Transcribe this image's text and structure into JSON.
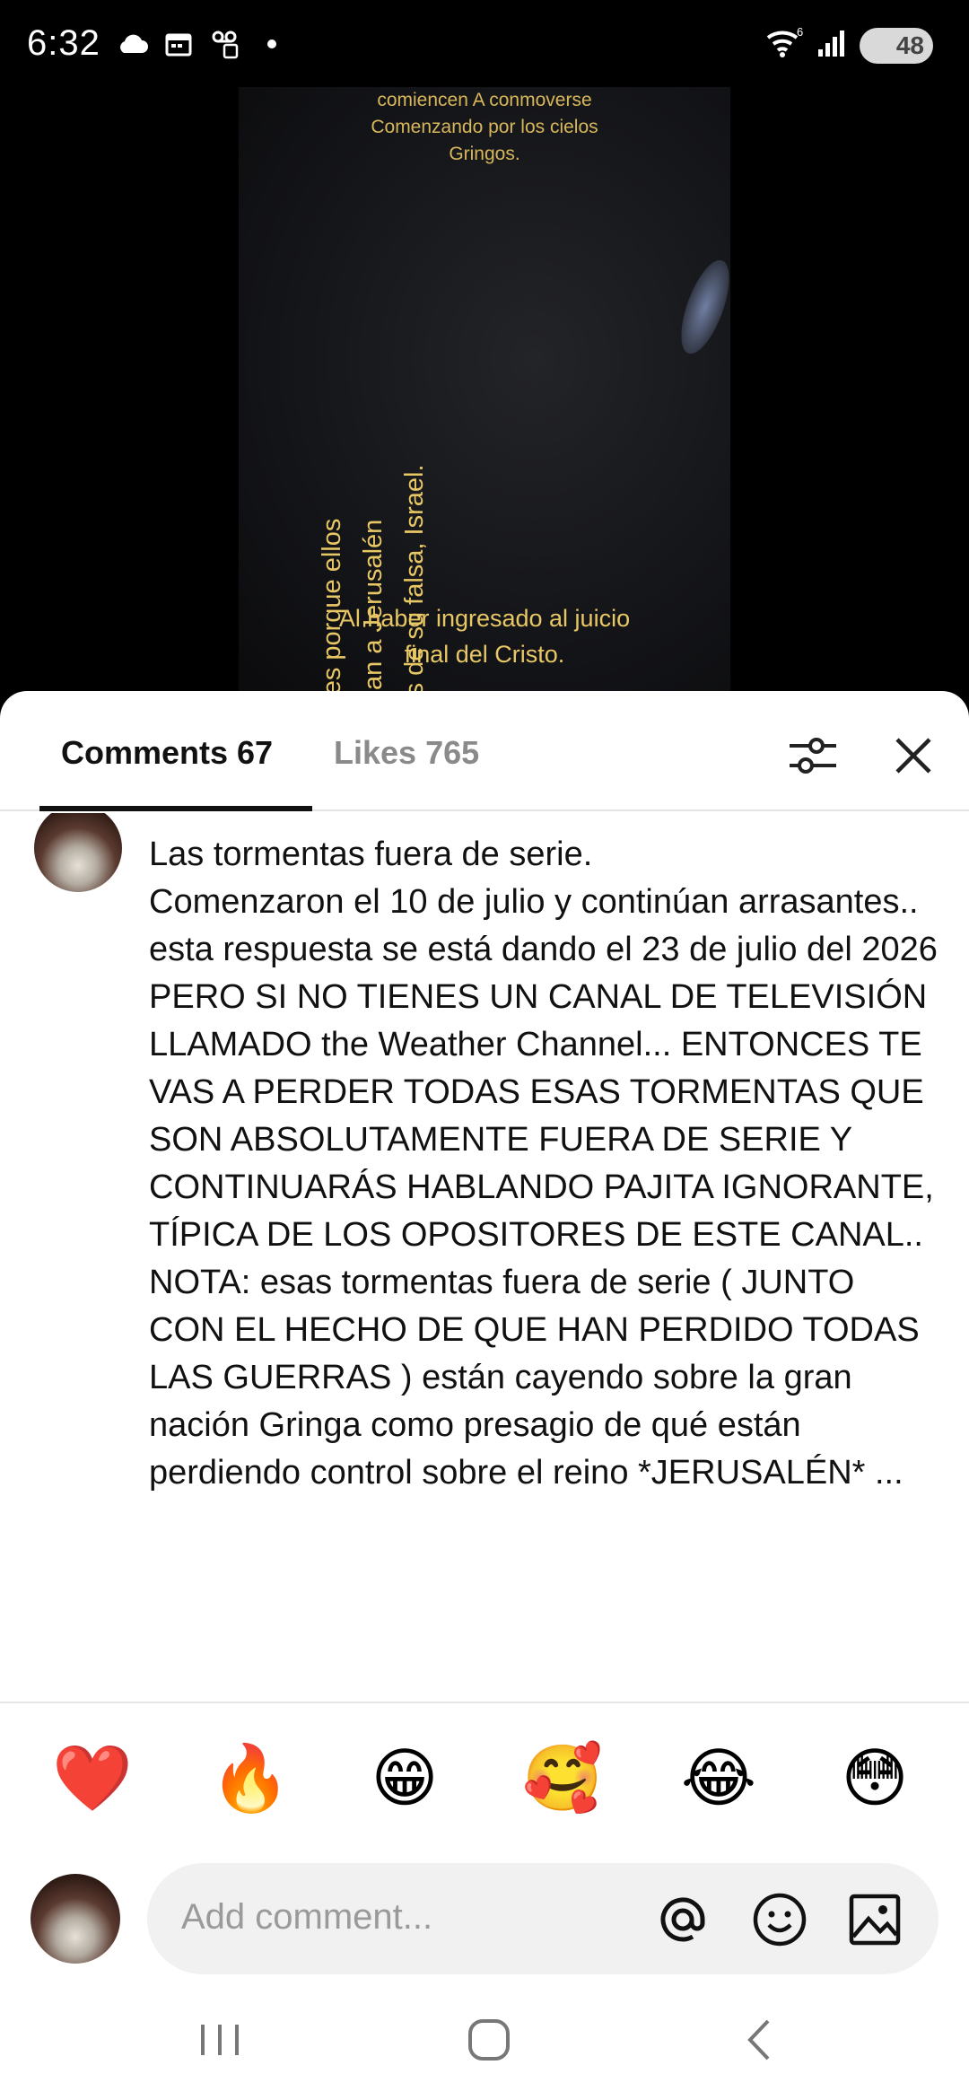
{
  "status_bar": {
    "time": "6:32",
    "network_label": "6",
    "battery": "48",
    "icons": [
      "cloud-icon",
      "calendar-icon",
      "voicemail-icon",
      "dot-icon",
      "wifi-icon",
      "signal-icon",
      "battery-icon"
    ]
  },
  "video": {
    "top_text_lines": [
      "comiencen A conmoverse",
      "Comenzando por los cielos",
      "Gringos."
    ],
    "vertical_text_lines": [
      "Y eso es porque ellos",
      "controlan a Jerusalén",
      "através de su falsa, Israel."
    ],
    "bottom_text_lines": [
      "Al haber ingresado al juicio",
      "final del Cristo."
    ]
  },
  "sheet": {
    "tabs": [
      {
        "label": "Comments",
        "count": "67",
        "active": true
      },
      {
        "label": "Likes",
        "count": "765",
        "active": false
      }
    ]
  },
  "comment": {
    "text": "Las tormentas fuera de serie.\nComenzaron el 10 de julio y continúan arrasantes.. esta respuesta se está dando el 23 de julio del 2026\nPERO SI NO TIENES UN CANAL DE TELEVISIÓN LLAMADO the Weather Channel... ENTONCES TE VAS A PERDER TODAS ESAS TORMENTAS QUE SON ABSOLUTAMENTE FUERA DE SERIE Y CONTINUARÁS HABLANDO PAJITA IGNORANTE, TÍPICA DE LOS OPOSITORES DE ESTE CANAL..\nNOTA: esas tormentas fuera de serie ( JUNTO CON EL HECHO DE QUE HAN PERDIDO TODAS LAS GUERRAS ) están cayendo sobre la gran nación Gringa como presagio de qué están perdiendo control sobre el reino *JERUSALÉN* ..."
  },
  "emojis": [
    "❤️",
    "🔥",
    "😁",
    "🥰",
    "😂",
    "😳"
  ],
  "input": {
    "placeholder": "Add comment..."
  },
  "colors": {
    "accent_text": "#e8c765",
    "sheet_bg": "#ffffff",
    "input_bg": "#f1f1f1",
    "tab_inactive": "#8a8a8a"
  }
}
